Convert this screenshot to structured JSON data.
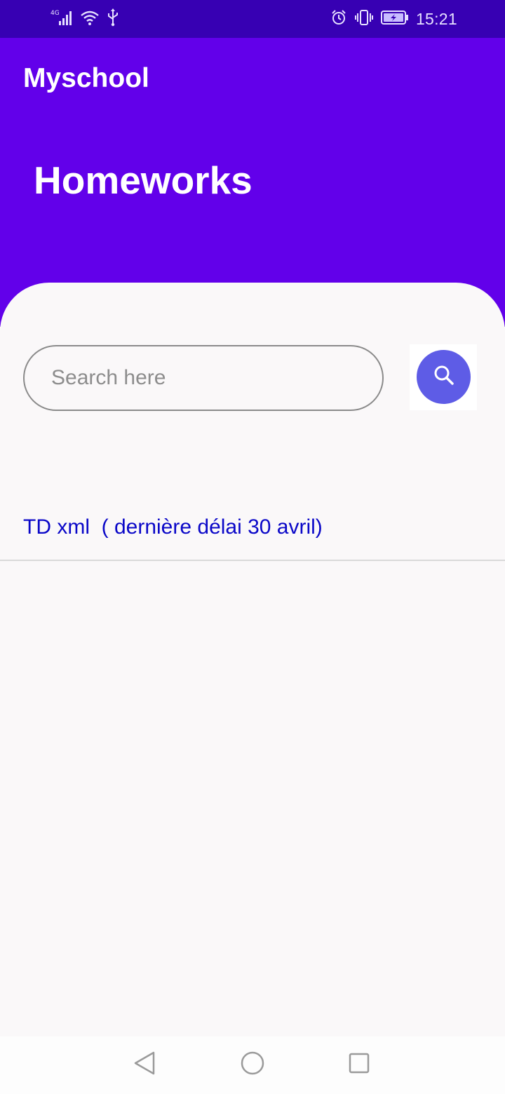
{
  "status_bar": {
    "network": "4G",
    "time": "15:21",
    "icons_left": [
      "signal-icon",
      "wifi-icon",
      "usb-icon"
    ],
    "icons_right": [
      "alarm-icon",
      "vibrate-icon",
      "battery-charging-icon"
    ]
  },
  "app_bar": {
    "title": "Myschool"
  },
  "header": {
    "title": "Homeworks"
  },
  "search": {
    "placeholder": "Search here",
    "value": ""
  },
  "homeworks": [
    {
      "label": "TD xml  ( dernière délai 30 avril)"
    }
  ],
  "navigation": {
    "buttons": [
      "back-icon",
      "home-icon",
      "recents-icon"
    ]
  },
  "colors": {
    "status_bar": "#3700b3",
    "primary": "#6200ea",
    "background": "#faf8f9",
    "search_button": "#5e5ce6",
    "item_text": "#0a07c8"
  }
}
